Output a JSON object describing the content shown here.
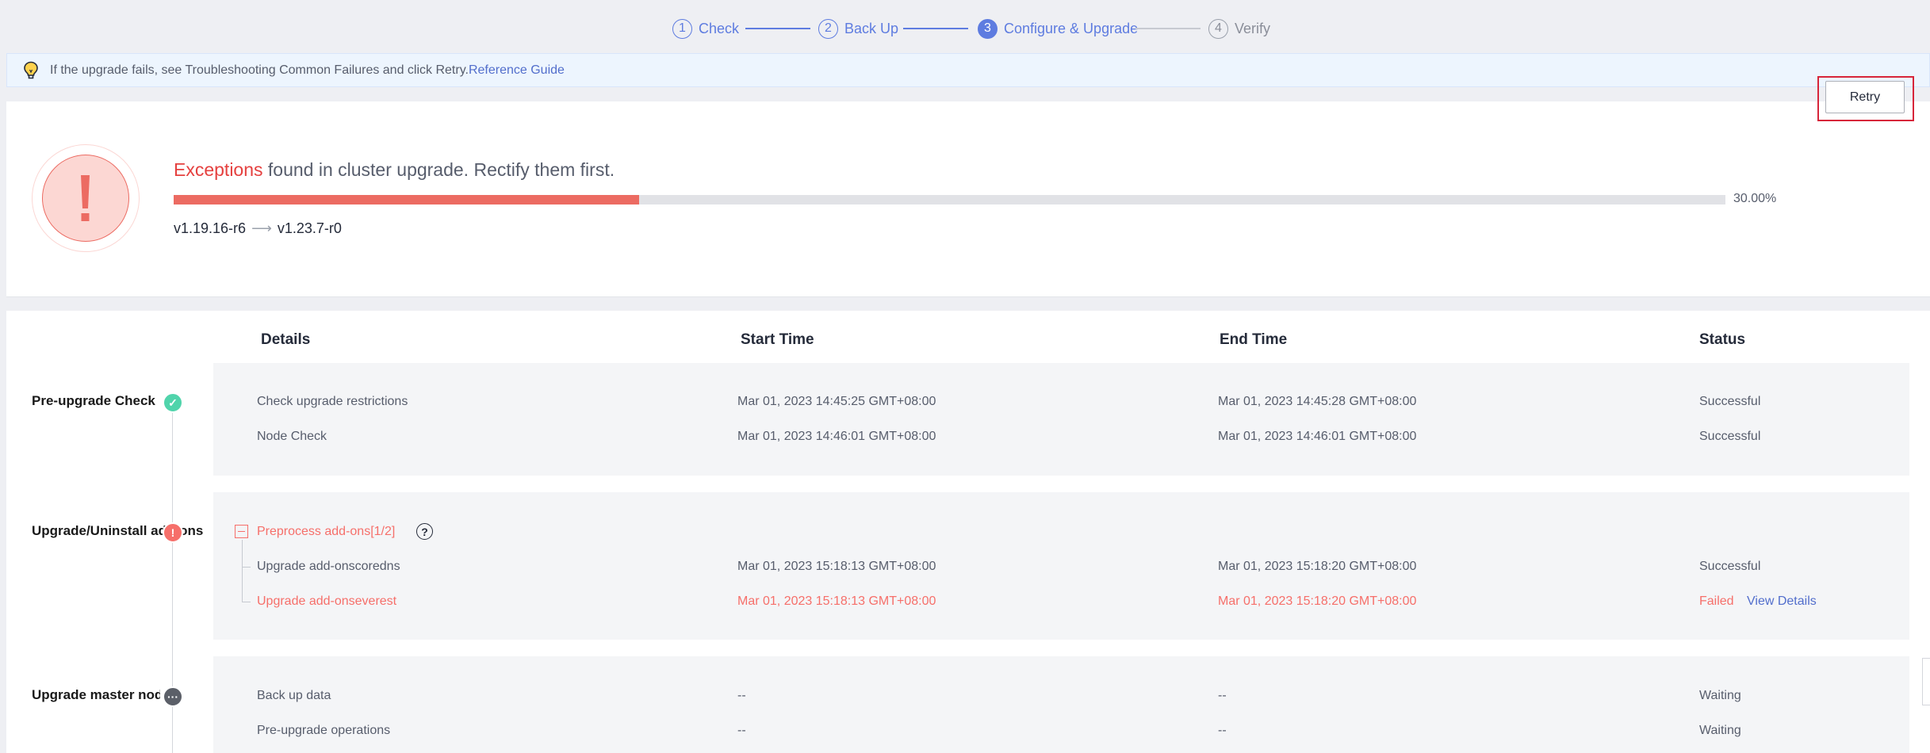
{
  "steps": [
    {
      "num": "1",
      "label": "Check",
      "state": "done"
    },
    {
      "num": "2",
      "label": "Back Up",
      "state": "done"
    },
    {
      "num": "3",
      "label": "Configure & Upgrade",
      "state": "active"
    },
    {
      "num": "4",
      "label": "Verify",
      "state": "pending"
    }
  ],
  "notice": {
    "icon": "lightbulb-icon",
    "text": "If the upgrade fails, see Troubleshooting Common Failures and click Retry.",
    "link": "Reference Guide"
  },
  "progress_card": {
    "alert_icon": "exclamation-icon",
    "exception_word": "Exceptions",
    "message_rest": " found in cluster upgrade. Rectify them first.",
    "progress": 0.3,
    "progress_label": "30.00%",
    "version_from": "v1.19.16-r6",
    "version_to": "v1.23.7-r0",
    "retry_label": "Retry"
  },
  "columns": {
    "details": "Details",
    "start": "Start Time",
    "end": "End Time",
    "status": "Status"
  },
  "stages": [
    {
      "name": "Pre-upgrade Check",
      "state": "success",
      "rows": [
        {
          "detail": "Check upgrade restrictions",
          "start": "Mar 01, 2023 14:45:25 GMT+08:00",
          "end": "Mar 01, 2023 14:45:28 GMT+08:00",
          "status": "Successful"
        },
        {
          "detail": "Node Check",
          "start": "Mar 01, 2023 14:46:01 GMT+08:00",
          "end": "Mar 01, 2023 14:46:01 GMT+08:00",
          "status": "Successful"
        }
      ]
    },
    {
      "name": "Upgrade/Uninstall add-ons",
      "state": "error",
      "group_label": "Preprocess add-ons[1/2]",
      "rows": [
        {
          "detail": "Upgrade add-onscoredns",
          "start": "Mar 01, 2023 15:18:13 GMT+08:00",
          "end": "Mar 01, 2023 15:18:20 GMT+08:00",
          "status": "Successful"
        },
        {
          "detail": "Upgrade add-onseverest",
          "start": "Mar 01, 2023 15:18:13 GMT+08:00",
          "end": "Mar 01, 2023 15:18:20 GMT+08:00",
          "status": "Failed",
          "action": "View Details"
        }
      ]
    },
    {
      "name": "Upgrade master nodes",
      "state": "waiting",
      "rows": [
        {
          "detail": "Back up data",
          "start": "--",
          "end": "--",
          "status": "Waiting"
        },
        {
          "detail": "Pre-upgrade operations",
          "start": "--",
          "end": "--",
          "status": "Waiting"
        }
      ]
    }
  ],
  "colors": {
    "accent": "#5e7ce0",
    "error": "#f66f6a",
    "success": "#50d4ab",
    "highlight_frame": "#d7253a"
  }
}
